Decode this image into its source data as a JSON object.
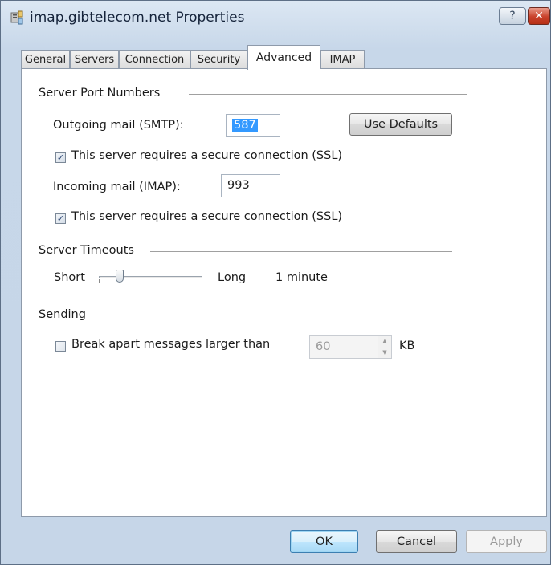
{
  "window": {
    "title": "imap.gibtelecom.net Properties",
    "help_glyph": "?",
    "close_glyph": "✕"
  },
  "tabs": [
    {
      "label": "General"
    },
    {
      "label": "Servers"
    },
    {
      "label": "Connection"
    },
    {
      "label": "Security"
    },
    {
      "label": "Advanced",
      "active": true
    },
    {
      "label": "IMAP"
    }
  ],
  "ports": {
    "group_label": "Server Port Numbers",
    "outgoing_label": "Outgoing mail (SMTP):",
    "outgoing_value": "587",
    "use_defaults_label": "Use Defaults",
    "outgoing_ssl_label": "This server requires a secure connection (SSL)",
    "outgoing_ssl_checked": true,
    "incoming_label": "Incoming mail (IMAP):",
    "incoming_value": "993",
    "incoming_ssl_label": "This server requires a secure connection (SSL)",
    "incoming_ssl_checked": true
  },
  "timeouts": {
    "group_label": "Server Timeouts",
    "short_label": "Short",
    "long_label": "Long",
    "value_label": "1 minute",
    "slider_fraction": 0.2
  },
  "sending": {
    "group_label": "Sending",
    "break_apart_label": "Break apart messages larger than",
    "break_apart_checked": false,
    "size_value": "60",
    "size_unit": "KB"
  },
  "footer": {
    "ok_label": "OK",
    "cancel_label": "Cancel",
    "apply_label": "Apply"
  },
  "colors": {
    "selection": "#3399ff",
    "close_button": "#c9412b",
    "default_button_border": "#3c7fb1"
  },
  "icons": {
    "app": "mail-server-icon",
    "check": "✓"
  }
}
